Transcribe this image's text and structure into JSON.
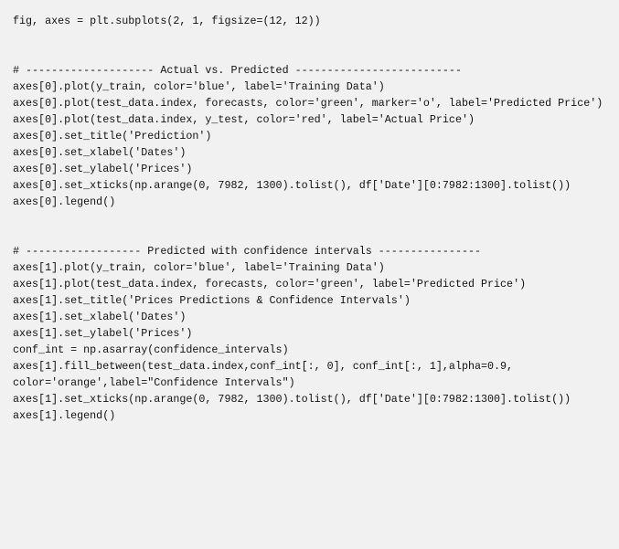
{
  "document": {
    "type": "code-block",
    "language": "python",
    "background_color": "#f1f1f1",
    "text_color": "#111111",
    "code_lines": [
      "fig, axes = plt.subplots(2, 1, figsize=(12, 12))",
      "",
      "",
      "# -------------------- Actual vs. Predicted --------------------------",
      "axes[0].plot(y_train, color='blue', label='Training Data')",
      "axes[0].plot(test_data.index, forecasts, color='green', marker='o', label='Predicted Price')",
      "axes[0].plot(test_data.index, y_test, color='red', label='Actual Price')",
      "axes[0].set_title('Prediction')",
      "axes[0].set_xlabel('Dates')",
      "axes[0].set_ylabel('Prices')",
      "axes[0].set_xticks(np.arange(0, 7982, 1300).tolist(), df['Date'][0:7982:1300].tolist())",
      "axes[0].legend()",
      "",
      "",
      "# ------------------ Predicted with confidence intervals ----------------",
      "axes[1].plot(y_train, color='blue', label='Training Data')",
      "axes[1].plot(test_data.index, forecasts, color='green', label='Predicted Price')",
      "axes[1].set_title('Prices Predictions & Confidence Intervals')",
      "axes[1].set_xlabel('Dates')",
      "axes[1].set_ylabel('Prices')",
      "conf_int = np.asarray(confidence_intervals)",
      "axes[1].fill_between(test_data.index,conf_int[:, 0], conf_int[:, 1],alpha=0.9, color='orange',label=\"Confidence Intervals\")",
      "axes[1].set_xticks(np.arange(0, 7982, 1300).tolist(), df['Date'][0:7982:1300].tolist())",
      "axes[1].legend()"
    ]
  }
}
